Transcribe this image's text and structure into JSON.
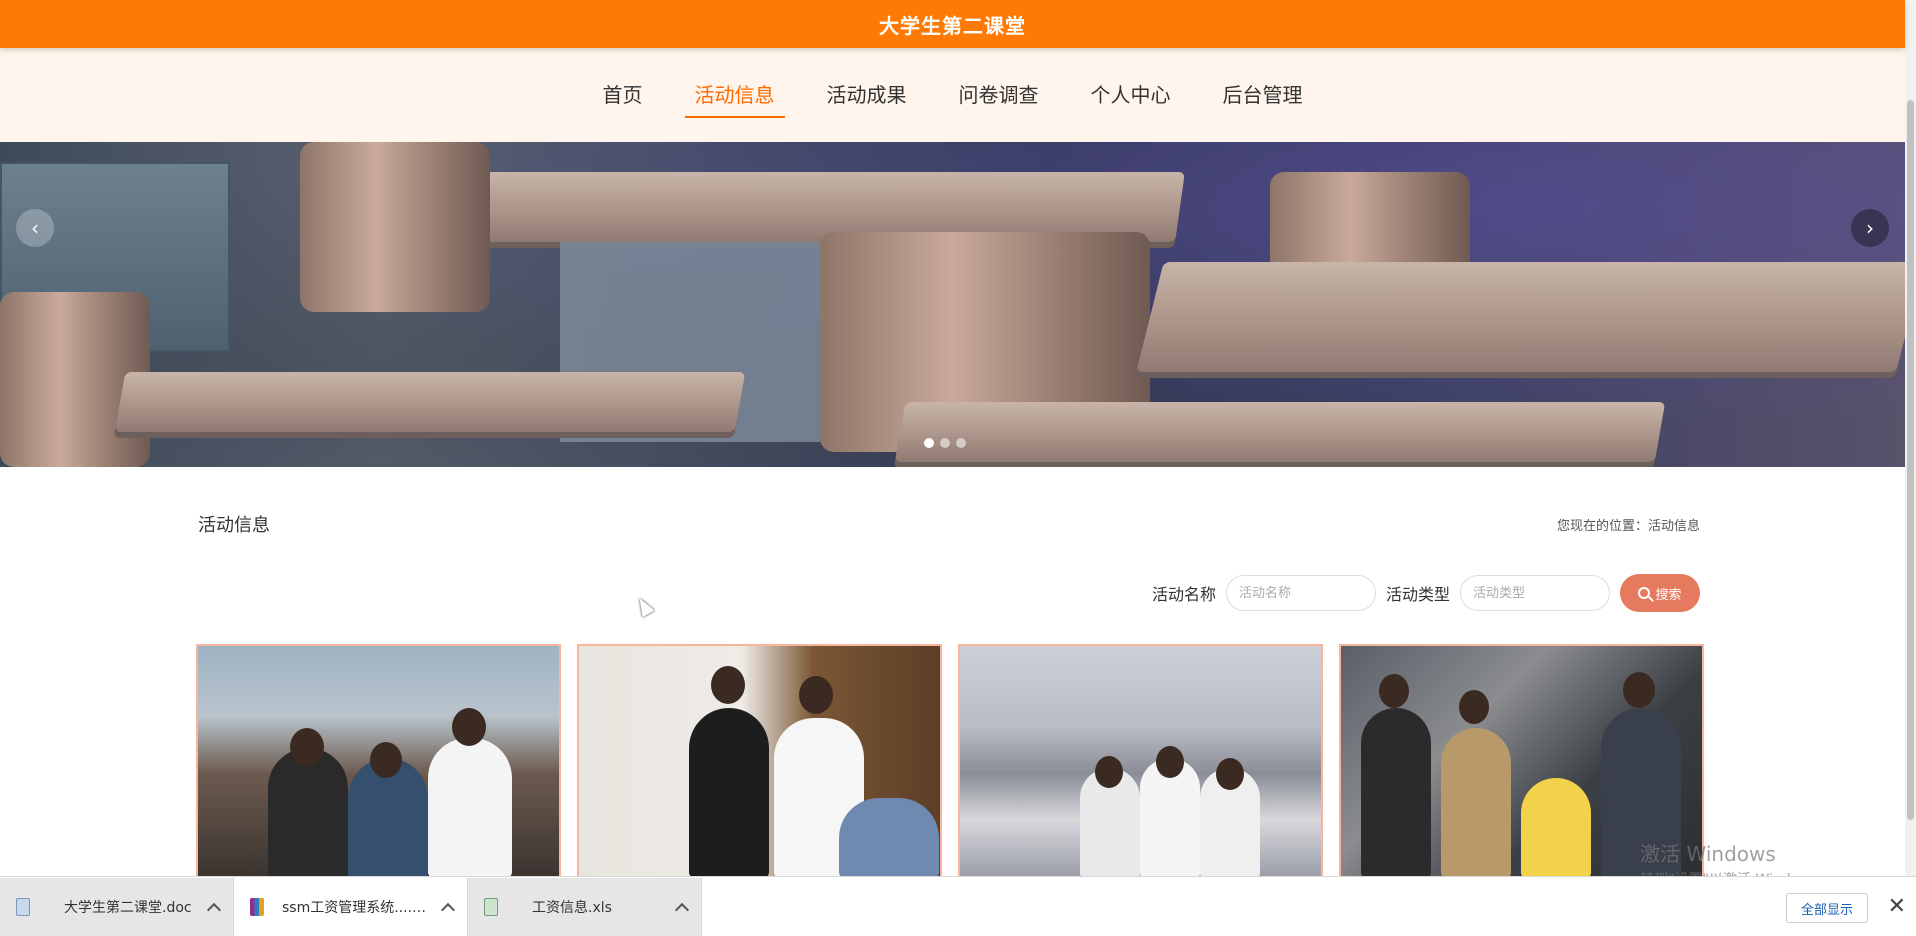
{
  "header": {
    "title": "大学生第二课堂"
  },
  "nav": {
    "items": [
      {
        "label": "首页"
      },
      {
        "label": "活动信息"
      },
      {
        "label": "活动成果"
      },
      {
        "label": "问卷调查"
      },
      {
        "label": "个人中心"
      },
      {
        "label": "后台管理"
      }
    ],
    "active_index": 1
  },
  "banner": {
    "prev_symbol": "‹",
    "next_symbol": "›",
    "slide_count": 3,
    "active_slide": 1
  },
  "section": {
    "title": "活动信息",
    "breadcrumb": "您现在的位置：活动信息"
  },
  "search": {
    "name_label": "活动名称",
    "name_placeholder": "活动名称",
    "type_label": "活动类型",
    "type_placeholder": "活动类型",
    "button_label": "搜索",
    "button_icon": "search-icon"
  },
  "download_bar": {
    "items": [
      {
        "name": "大学生第二课堂.doc",
        "icon": "word-doc-icon"
      },
      {
        "name": "ssm工资管理系统....zip",
        "icon": "zip-archive-icon"
      },
      {
        "name": "工资信息.xls",
        "icon": "excel-doc-icon"
      }
    ],
    "show_all": "全部显示",
    "close": "✕"
  },
  "watermark": {
    "line1": "激活 Windows",
    "line2": "转到\"设置\"以激活 Windows。"
  },
  "colors": {
    "brand": "#ff7a05",
    "nav_bg": "#fff5ec",
    "active": "#ff6a00",
    "button": "#e57a5f",
    "card_border": "#f6b59c"
  }
}
